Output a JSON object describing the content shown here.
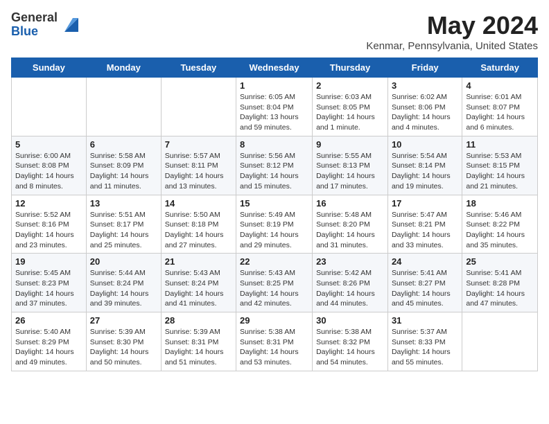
{
  "header": {
    "logo_general": "General",
    "logo_blue": "Blue",
    "month_title": "May 2024",
    "location": "Kenmar, Pennsylvania, United States"
  },
  "weekdays": [
    "Sunday",
    "Monday",
    "Tuesday",
    "Wednesday",
    "Thursday",
    "Friday",
    "Saturday"
  ],
  "weeks": [
    [
      {
        "day": "",
        "info": ""
      },
      {
        "day": "",
        "info": ""
      },
      {
        "day": "",
        "info": ""
      },
      {
        "day": "1",
        "info": "Sunrise: 6:05 AM\nSunset: 8:04 PM\nDaylight: 13 hours\nand 59 minutes."
      },
      {
        "day": "2",
        "info": "Sunrise: 6:03 AM\nSunset: 8:05 PM\nDaylight: 14 hours\nand 1 minute."
      },
      {
        "day": "3",
        "info": "Sunrise: 6:02 AM\nSunset: 8:06 PM\nDaylight: 14 hours\nand 4 minutes."
      },
      {
        "day": "4",
        "info": "Sunrise: 6:01 AM\nSunset: 8:07 PM\nDaylight: 14 hours\nand 6 minutes."
      }
    ],
    [
      {
        "day": "5",
        "info": "Sunrise: 6:00 AM\nSunset: 8:08 PM\nDaylight: 14 hours\nand 8 minutes."
      },
      {
        "day": "6",
        "info": "Sunrise: 5:58 AM\nSunset: 8:09 PM\nDaylight: 14 hours\nand 11 minutes."
      },
      {
        "day": "7",
        "info": "Sunrise: 5:57 AM\nSunset: 8:11 PM\nDaylight: 14 hours\nand 13 minutes."
      },
      {
        "day": "8",
        "info": "Sunrise: 5:56 AM\nSunset: 8:12 PM\nDaylight: 14 hours\nand 15 minutes."
      },
      {
        "day": "9",
        "info": "Sunrise: 5:55 AM\nSunset: 8:13 PM\nDaylight: 14 hours\nand 17 minutes."
      },
      {
        "day": "10",
        "info": "Sunrise: 5:54 AM\nSunset: 8:14 PM\nDaylight: 14 hours\nand 19 minutes."
      },
      {
        "day": "11",
        "info": "Sunrise: 5:53 AM\nSunset: 8:15 PM\nDaylight: 14 hours\nand 21 minutes."
      }
    ],
    [
      {
        "day": "12",
        "info": "Sunrise: 5:52 AM\nSunset: 8:16 PM\nDaylight: 14 hours\nand 23 minutes."
      },
      {
        "day": "13",
        "info": "Sunrise: 5:51 AM\nSunset: 8:17 PM\nDaylight: 14 hours\nand 25 minutes."
      },
      {
        "day": "14",
        "info": "Sunrise: 5:50 AM\nSunset: 8:18 PM\nDaylight: 14 hours\nand 27 minutes."
      },
      {
        "day": "15",
        "info": "Sunrise: 5:49 AM\nSunset: 8:19 PM\nDaylight: 14 hours\nand 29 minutes."
      },
      {
        "day": "16",
        "info": "Sunrise: 5:48 AM\nSunset: 8:20 PM\nDaylight: 14 hours\nand 31 minutes."
      },
      {
        "day": "17",
        "info": "Sunrise: 5:47 AM\nSunset: 8:21 PM\nDaylight: 14 hours\nand 33 minutes."
      },
      {
        "day": "18",
        "info": "Sunrise: 5:46 AM\nSunset: 8:22 PM\nDaylight: 14 hours\nand 35 minutes."
      }
    ],
    [
      {
        "day": "19",
        "info": "Sunrise: 5:45 AM\nSunset: 8:23 PM\nDaylight: 14 hours\nand 37 minutes."
      },
      {
        "day": "20",
        "info": "Sunrise: 5:44 AM\nSunset: 8:24 PM\nDaylight: 14 hours\nand 39 minutes."
      },
      {
        "day": "21",
        "info": "Sunrise: 5:43 AM\nSunset: 8:24 PM\nDaylight: 14 hours\nand 41 minutes."
      },
      {
        "day": "22",
        "info": "Sunrise: 5:43 AM\nSunset: 8:25 PM\nDaylight: 14 hours\nand 42 minutes."
      },
      {
        "day": "23",
        "info": "Sunrise: 5:42 AM\nSunset: 8:26 PM\nDaylight: 14 hours\nand 44 minutes."
      },
      {
        "day": "24",
        "info": "Sunrise: 5:41 AM\nSunset: 8:27 PM\nDaylight: 14 hours\nand 45 minutes."
      },
      {
        "day": "25",
        "info": "Sunrise: 5:41 AM\nSunset: 8:28 PM\nDaylight: 14 hours\nand 47 minutes."
      }
    ],
    [
      {
        "day": "26",
        "info": "Sunrise: 5:40 AM\nSunset: 8:29 PM\nDaylight: 14 hours\nand 49 minutes."
      },
      {
        "day": "27",
        "info": "Sunrise: 5:39 AM\nSunset: 8:30 PM\nDaylight: 14 hours\nand 50 minutes."
      },
      {
        "day": "28",
        "info": "Sunrise: 5:39 AM\nSunset: 8:31 PM\nDaylight: 14 hours\nand 51 minutes."
      },
      {
        "day": "29",
        "info": "Sunrise: 5:38 AM\nSunset: 8:31 PM\nDaylight: 14 hours\nand 53 minutes."
      },
      {
        "day": "30",
        "info": "Sunrise: 5:38 AM\nSunset: 8:32 PM\nDaylight: 14 hours\nand 54 minutes."
      },
      {
        "day": "31",
        "info": "Sunrise: 5:37 AM\nSunset: 8:33 PM\nDaylight: 14 hours\nand 55 minutes."
      },
      {
        "day": "",
        "info": ""
      }
    ]
  ]
}
